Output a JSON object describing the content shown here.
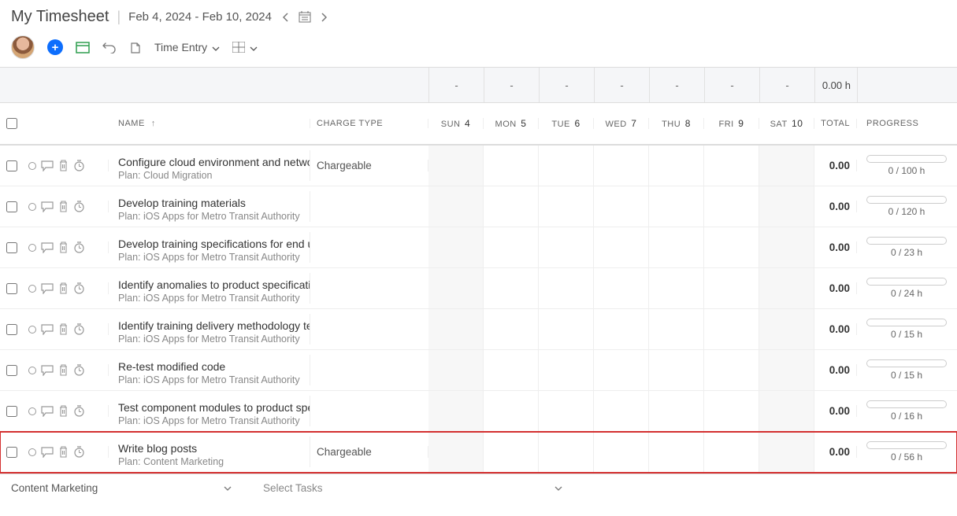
{
  "header": {
    "title": "My Timesheet",
    "date_range": "Feb 4, 2024 - Feb 10, 2024"
  },
  "toolbar": {
    "mode_label": "Time Entry"
  },
  "summary": {
    "days": [
      "-",
      "-",
      "-",
      "-",
      "-",
      "-",
      "-"
    ],
    "total": "0.00 h"
  },
  "columns": {
    "name": "Name",
    "charge": "Charge Type",
    "days": [
      {
        "label": "Sun",
        "num": "4"
      },
      {
        "label": "Mon",
        "num": "5"
      },
      {
        "label": "Tue",
        "num": "6"
      },
      {
        "label": "Wed",
        "num": "7"
      },
      {
        "label": "Thu",
        "num": "8"
      },
      {
        "label": "Fri",
        "num": "9"
      },
      {
        "label": "Sat",
        "num": "10"
      }
    ],
    "total": "Total",
    "progress": "Progress"
  },
  "rows": [
    {
      "name": "Configure cloud environment and network",
      "plan": "Plan: Cloud Migration",
      "charge": "Chargeable",
      "total": "0.00",
      "progress": "0 / 100 h",
      "highlighted": false
    },
    {
      "name": "Develop training materials",
      "plan": "Plan: iOS Apps for Metro Transit Authority",
      "charge": "",
      "total": "0.00",
      "progress": "0 / 120 h",
      "highlighted": false
    },
    {
      "name": "Develop training specifications for end users",
      "plan": "Plan: iOS Apps for Metro Transit Authority",
      "charge": "",
      "total": "0.00",
      "progress": "0 / 23 h",
      "highlighted": false
    },
    {
      "name": "Identify anomalies to product specifications",
      "plan": "Plan: iOS Apps for Metro Transit Authority",
      "charge": "",
      "total": "0.00",
      "progress": "0 / 24 h",
      "highlighted": false
    },
    {
      "name": "Identify training delivery methodology team",
      "plan": "Plan: iOS Apps for Metro Transit Authority",
      "charge": "",
      "total": "0.00",
      "progress": "0 / 15 h",
      "highlighted": false
    },
    {
      "name": "Re-test modified code",
      "plan": "Plan: iOS Apps for Metro Transit Authority",
      "charge": "",
      "total": "0.00",
      "progress": "0 / 15 h",
      "highlighted": false
    },
    {
      "name": "Test component modules to product specs",
      "plan": "Plan: iOS Apps for Metro Transit Authority",
      "charge": "",
      "total": "0.00",
      "progress": "0 / 16 h",
      "highlighted": false
    },
    {
      "name": "Write blog posts",
      "plan": "Plan: Content Marketing",
      "charge": "Chargeable",
      "total": "0.00",
      "progress": "0 / 56 h",
      "highlighted": true
    }
  ],
  "footer": {
    "project_selected": "Content Marketing",
    "task_placeholder": "Select Tasks"
  }
}
